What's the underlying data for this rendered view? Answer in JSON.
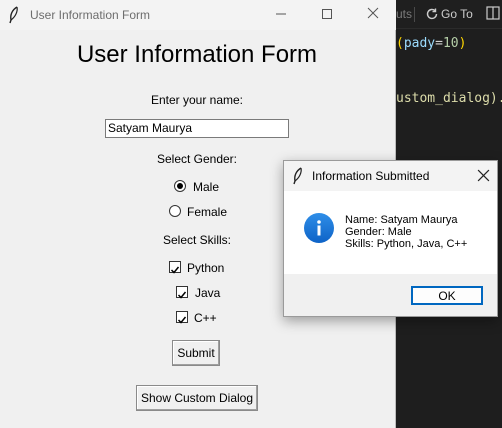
{
  "editor": {
    "toolbar_left": "uts",
    "toolbar_goto": "Go To",
    "code_line1": {
      "paren": "(",
      "id": "pady",
      "op": "=",
      "num": "10",
      "paren_close": ")"
    },
    "code_line2": "ustom_dialog)."
  },
  "main_window": {
    "title": "User Information Form",
    "heading": "User Information Form",
    "name_label": "Enter your name:",
    "name_value": "Satyam Maurya",
    "gender_label": "Select Gender:",
    "gender_options": [
      {
        "label": "Male",
        "selected": true
      },
      {
        "label": "Female",
        "selected": false
      }
    ],
    "skills_label": "Select Skills:",
    "skills": [
      {
        "label": "Python",
        "checked": true
      },
      {
        "label": "Java",
        "checked": true
      },
      {
        "label": "C++",
        "checked": true
      }
    ],
    "submit_label": "Submit",
    "custom_dialog_label": "Show Custom Dialog"
  },
  "dialog": {
    "title": "Information Submitted",
    "message": "Name: Satyam Maurya\nGender: Male\nSkills: Python, Java, C++",
    "ok_label": "OK",
    "icon": "info-icon"
  },
  "colors": {
    "editor_bg": "#1e1e1e",
    "window_bg": "#f0f0f0",
    "accent": "#0067c0",
    "info_icon": "#1a73d9"
  }
}
